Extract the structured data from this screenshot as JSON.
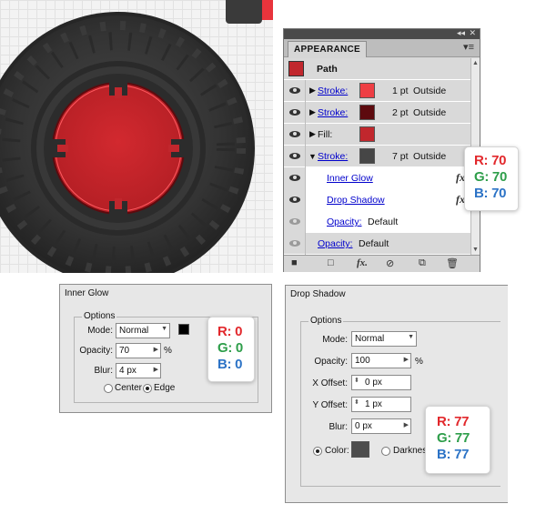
{
  "appearance": {
    "tab_title": "APPEARANCE",
    "collapse_icon": "double-chevron-icon",
    "close_icon": "close-icon",
    "menu_icon": "panel-menu-icon",
    "path_label": "Path",
    "path_color": "#c1272d",
    "rows": [
      {
        "label": "Stroke:",
        "swatch": "#ee3e44",
        "weight": "1 pt",
        "align": "Outside"
      },
      {
        "label": "Stroke:",
        "swatch": "#5d0a0e",
        "weight": "2 pt",
        "align": "Outside"
      },
      {
        "label": "Fill:",
        "swatch": "#c1272d"
      },
      {
        "label": "Stroke:",
        "swatch": "#464646",
        "weight": "7 pt",
        "align": "Outside"
      }
    ],
    "effects": [
      "Inner Glow",
      "Drop Shadow"
    ],
    "opacity_label": "Opacity:",
    "opacity_value": "Default",
    "footer_icons": [
      "new-art-icon",
      "add-stroke-icon",
      "add-fill-icon",
      "add-effect-icon",
      "clear-icon",
      "duplicate-icon",
      "delete-icon"
    ]
  },
  "appearance_callout": {
    "r": "R: 70",
    "g": "G: 70",
    "b": "B: 70"
  },
  "inner_glow": {
    "title": "Inner Glow",
    "group_label": "Options",
    "mode_label": "Mode:",
    "mode_value": "Normal",
    "color": "#000000",
    "opacity_label": "Opacity:",
    "opacity_value": "70",
    "opacity_unit": "%",
    "blur_label": "Blur:",
    "blur_value": "4 px",
    "center_label": "Center",
    "edge_label": "Edge",
    "selected": "Edge"
  },
  "inner_glow_callout": {
    "r": "R: 0",
    "g": "G: 0",
    "b": "B: 0"
  },
  "drop_shadow": {
    "title": "Drop Shadow",
    "group_label": "Options",
    "mode_label": "Mode:",
    "mode_value": "Normal",
    "opacity_label": "Opacity:",
    "opacity_value": "100",
    "opacity_unit": "%",
    "xoffset_label": "X Offset:",
    "xoffset_value": "0 px",
    "yoffset_label": "Y Offset:",
    "yoffset_value": "1 px",
    "blur_label": "Blur:",
    "blur_value": "0 px",
    "color_label": "Color:",
    "color": "#4d4d4d",
    "darkness_label": "Darkness:"
  },
  "drop_shadow_callout": {
    "r": "R: 77",
    "g": "G: 77",
    "b": "B: 77"
  },
  "art_colors": {
    "tire": "#2e2e2e",
    "hub": "#c1272d",
    "hub_glow": "#ff5a60",
    "backdrop_red": "#e8343c"
  }
}
